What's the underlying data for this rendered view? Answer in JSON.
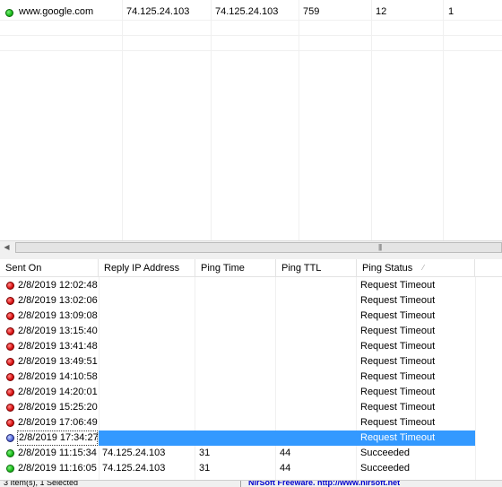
{
  "hosts": [
    {
      "status": "ok",
      "host_name": "www.google.com",
      "ip_address": "74.125.24.103",
      "reply_ip": "74.125.24.103",
      "col4": "759",
      "col5": "12",
      "col6": "1"
    }
  ],
  "log": {
    "columns": [
      "Sent On",
      "Reply IP Address",
      "Ping Time",
      "Ping TTL",
      "Ping Status"
    ],
    "sorted_column": "Ping Status",
    "rows": [
      {
        "status": "fail",
        "sent_on": "2/8/2019 12:02:48",
        "reply_ip": "",
        "ping_time": "",
        "ttl": "",
        "ping_status": "Request Timeout"
      },
      {
        "status": "fail",
        "sent_on": "2/8/2019 13:02:06",
        "reply_ip": "",
        "ping_time": "",
        "ttl": "",
        "ping_status": "Request Timeout"
      },
      {
        "status": "fail",
        "sent_on": "2/8/2019 13:09:08",
        "reply_ip": "",
        "ping_time": "",
        "ttl": "",
        "ping_status": "Request Timeout"
      },
      {
        "status": "fail",
        "sent_on": "2/8/2019 13:15:40",
        "reply_ip": "",
        "ping_time": "",
        "ttl": "",
        "ping_status": "Request Timeout"
      },
      {
        "status": "fail",
        "sent_on": "2/8/2019 13:41:48",
        "reply_ip": "",
        "ping_time": "",
        "ttl": "",
        "ping_status": "Request Timeout"
      },
      {
        "status": "fail",
        "sent_on": "2/8/2019 13:49:51",
        "reply_ip": "",
        "ping_time": "",
        "ttl": "",
        "ping_status": "Request Timeout"
      },
      {
        "status": "fail",
        "sent_on": "2/8/2019 14:10:58",
        "reply_ip": "",
        "ping_time": "",
        "ttl": "",
        "ping_status": "Request Timeout"
      },
      {
        "status": "fail",
        "sent_on": "2/8/2019 14:20:01",
        "reply_ip": "",
        "ping_time": "",
        "ttl": "",
        "ping_status": "Request Timeout"
      },
      {
        "status": "fail",
        "sent_on": "2/8/2019 15:25:20",
        "reply_ip": "",
        "ping_time": "",
        "ttl": "",
        "ping_status": "Request Timeout"
      },
      {
        "status": "fail",
        "sent_on": "2/8/2019 17:06:49",
        "reply_ip": "",
        "ping_time": "",
        "ttl": "",
        "ping_status": "Request Timeout"
      },
      {
        "status": "selected",
        "sent_on": "2/8/2019 17:34:27",
        "reply_ip": "",
        "ping_time": "",
        "ttl": "",
        "ping_status": "Request Timeout"
      },
      {
        "status": "ok",
        "sent_on": "2/8/2019 11:15:34",
        "reply_ip": "74.125.24.103",
        "ping_time": "31",
        "ttl": "44",
        "ping_status": "Succeeded"
      },
      {
        "status": "ok",
        "sent_on": "2/8/2019 11:16:05",
        "reply_ip": "74.125.24.103",
        "ping_time": "31",
        "ttl": "44",
        "ping_status": "Succeeded"
      }
    ]
  },
  "statusbar": {
    "left_text": "3 Item(s), 1 Selected",
    "link_text": "NirSoft Freeware.  http://www.nirsoft.net"
  },
  "colors": {
    "selection": "#3399ff",
    "ok_dot": "#1fbf1f",
    "fail_dot": "#e01818",
    "link": "#0000cc"
  },
  "icons": {
    "ok": "green-status-icon",
    "fail": "red-status-icon",
    "selected": "blue-status-icon"
  }
}
